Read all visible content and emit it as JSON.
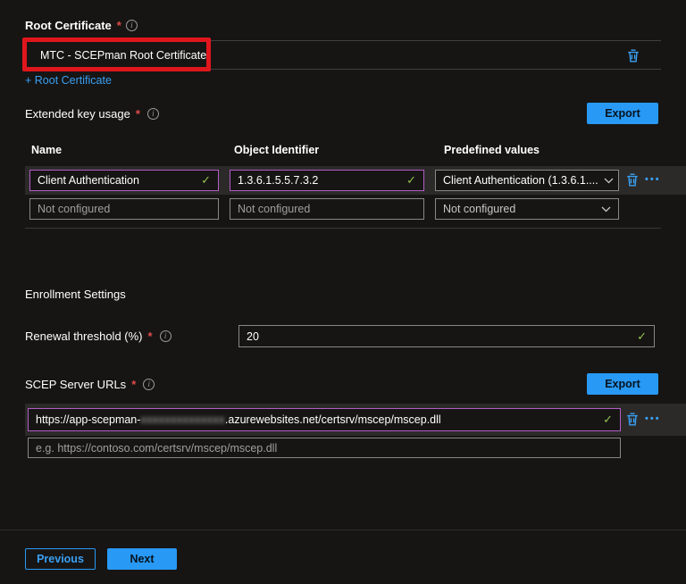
{
  "icons": {
    "check": "✓",
    "ellipsis": "•••",
    "info": "i"
  },
  "colors": {
    "accent_blue": "#2899f5",
    "link_blue": "#3aa0f3",
    "valid_green": "#93c04d",
    "modified_purple": "#b35cc6",
    "required_red": "#e14b4b",
    "annotation_red": "#e0161d"
  },
  "root_certificate": {
    "label": "Root Certificate",
    "required": "*",
    "value": "MTC - SCEPman Root Certificate",
    "add_link_label": "+ Root Certificate"
  },
  "extended_key_usage": {
    "label": "Extended key usage",
    "required": "*",
    "export_label": "Export",
    "headers": {
      "name": "Name",
      "oid": "Object Identifier",
      "predefined": "Predefined values"
    },
    "rows": [
      {
        "name": "Client Authentication",
        "oid": "1.3.6.1.5.5.7.3.2",
        "predefined": "Client Authentication (1.3.6.1...."
      },
      {
        "name": "Not configured",
        "oid": "Not configured",
        "predefined": "Not configured"
      }
    ]
  },
  "enrollment_settings": {
    "heading": "Enrollment Settings",
    "renewal_threshold": {
      "label": "Renewal threshold (%)",
      "required": "*",
      "value": "20"
    },
    "scep_server_urls": {
      "label": "SCEP Server URLs",
      "required": "*",
      "export_label": "Export",
      "url_prefix": "https://app-scepman-",
      "url_redacted": "xxxxxxxxxxxxxx",
      "url_suffix": ".azurewebsites.net/certsrv/mscep/mscep.dll",
      "url_placeholder": "e.g. https://contoso.com/certsrv/mscep/mscep.dll"
    }
  },
  "footer": {
    "previous_label": "Previous",
    "next_label": "Next"
  }
}
